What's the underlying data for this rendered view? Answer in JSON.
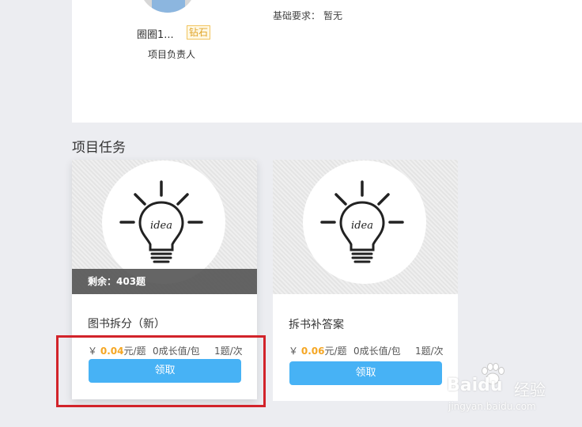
{
  "owner": {
    "name": "圈圈1...",
    "badge": "钻石",
    "role": "项目负责人"
  },
  "requirements": {
    "label": "基础要求：",
    "value": "暂无"
  },
  "section_title": "项目任务",
  "tasks": [
    {
      "remaining": "剩余：403题",
      "title": "图书拆分（新）",
      "currency": "￥",
      "price": "0.04",
      "price_unit": "元/题",
      "growth": "0成长值/包",
      "limit": "1题/次",
      "claim_label": "领取"
    },
    {
      "title": "拆书补答案",
      "currency": "￥",
      "price": "0.06",
      "price_unit": "元/题",
      "growth": "0成长值/包",
      "limit": "1题/次",
      "claim_label": "领取"
    }
  ],
  "icons": {
    "card_image": "lightbulb-idea-icon"
  },
  "colors": {
    "accent": "#47b2f5",
    "price": "#f5a623",
    "highlight": "#d2232a",
    "badge": "#e0a52a"
  },
  "watermark": {
    "logo_a": "Bai",
    "logo_b": "du",
    "brand": "经验",
    "url": "jingyan.baidu.com"
  }
}
